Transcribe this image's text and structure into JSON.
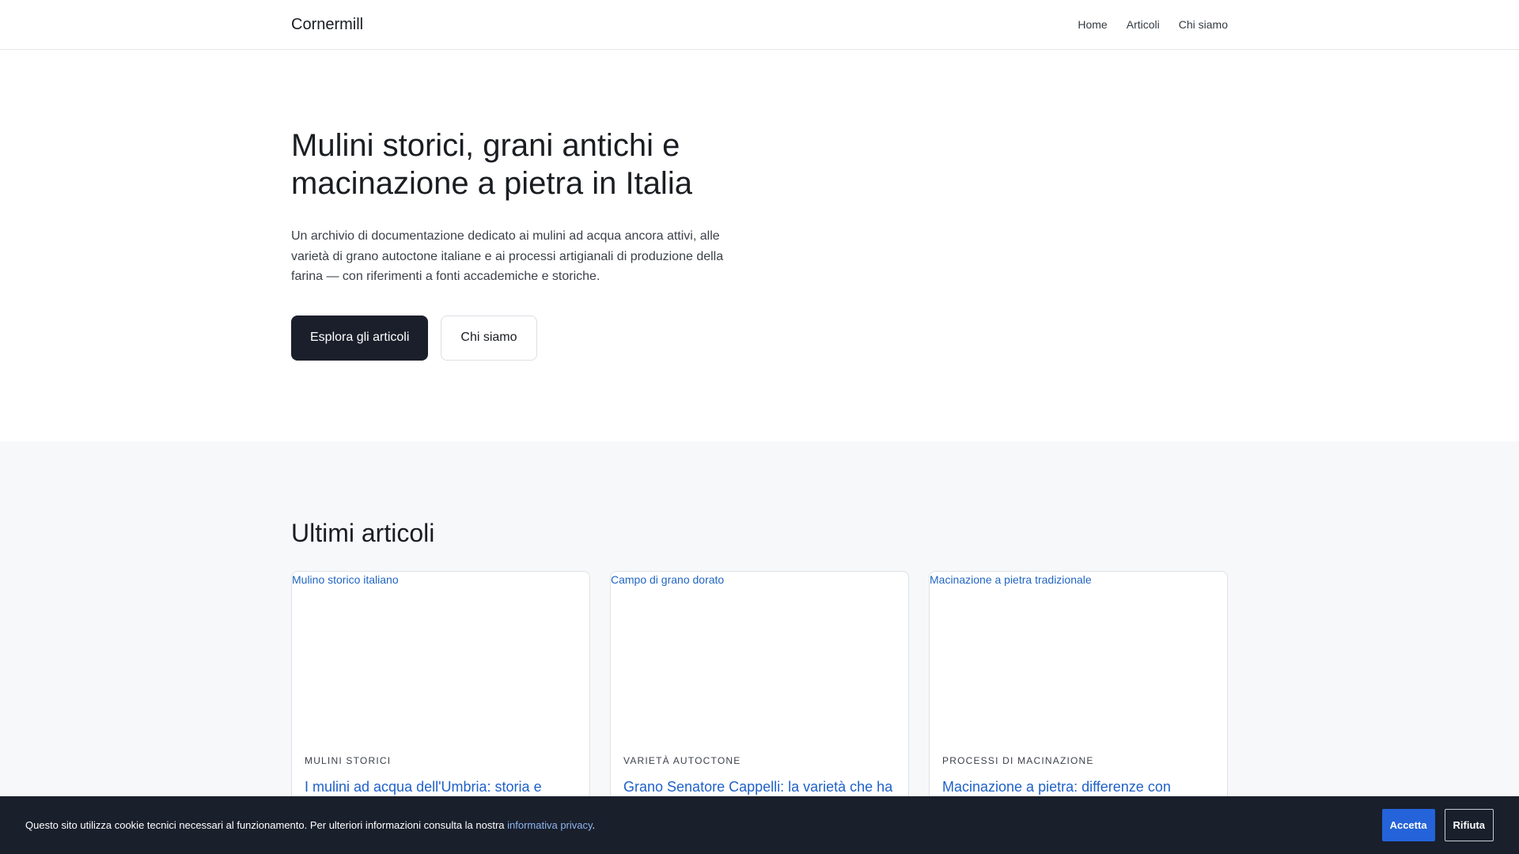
{
  "nav": {
    "brand": "Cornermill",
    "links": [
      "Home",
      "Articoli",
      "Chi siamo"
    ]
  },
  "hero": {
    "title": "Mulini storici, grani antichi e macinazione a pietra in Italia",
    "description": "Un archivio di documentazione dedicato ai mulini ad acqua ancora attivi, alle varietà di grano autoctone italiane e ai processi artigianali di produzione della farina — con riferimenti a fonti accademiche e storiche.",
    "primary_button": "Esplora gli articoli",
    "secondary_button": "Chi siamo"
  },
  "latest": {
    "heading": "Ultimi articoli",
    "cards": [
      {
        "image_alt": "Mulino storico italiano",
        "category": "MULINI STORICI",
        "title": "I mulini ad acqua dell'Umbria: storia e"
      },
      {
        "image_alt": "Campo di grano dorato",
        "category": "VARIETÀ AUTOCTONE",
        "title": "Grano Senatore Cappelli: la varietà che ha"
      },
      {
        "image_alt": "Macinazione a pietra tradizionale",
        "category": "PROCESSI DI MACINAZIONE",
        "title": "Macinazione a pietra: differenze con"
      }
    ]
  },
  "cookie": {
    "text": "Questo sito utilizza cookie tecnici necessari al funzionamento. Per ulteriori informazioni consulta la nostra ",
    "link": "informativa privacy",
    "suffix": ".",
    "accept": "Accetta",
    "reject": "Rifiuta"
  },
  "colors": {
    "dark": "#1a1f2b",
    "link_blue": "#1f61c9",
    "accept_blue": "#2463d9",
    "section_bg": "#f7f8fa"
  }
}
